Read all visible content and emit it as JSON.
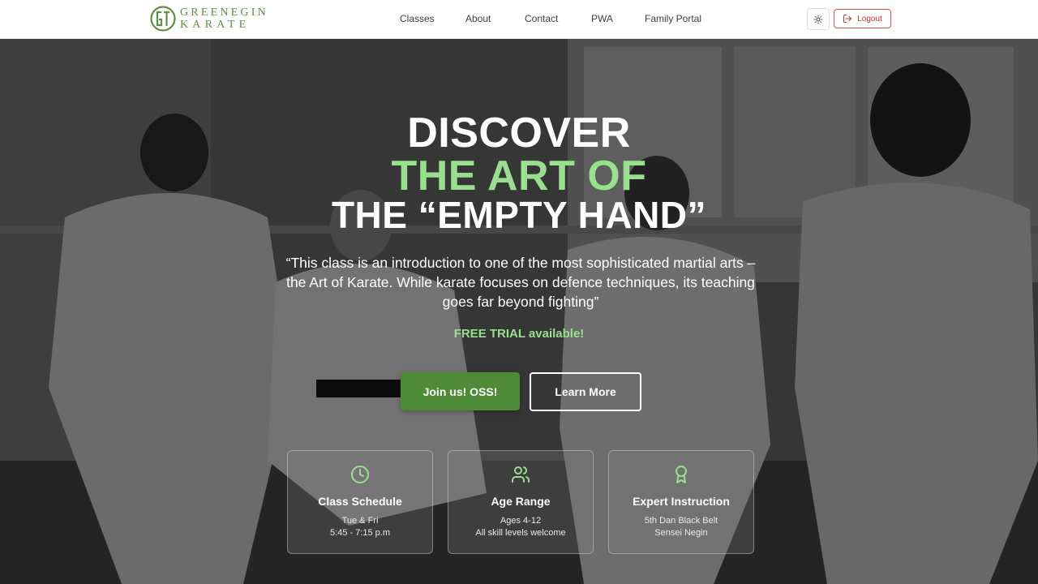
{
  "brand": {
    "line1": "GREENEGIN",
    "line2": "KARATE",
    "color": "#5e8f3f"
  },
  "nav": {
    "items": [
      "Classes",
      "About",
      "Contact",
      "PWA",
      "Family Portal"
    ]
  },
  "header_actions": {
    "theme_icon": "sun-icon",
    "logout_label": "Logout",
    "logout_icon": "logout-icon",
    "logout_color": "#c9302c"
  },
  "hero": {
    "line1": "DISCOVER",
    "line2": "THE ART OF",
    "line3": "THE “EMPTY HAND”",
    "accent_color": "#98e08e",
    "quote": "“This class is an introduction to one of the most sophisticated martial arts – the Art of Karate. While karate focuses on defence techniques, its teaching goes far beyond fighting”",
    "free_trial": "FREE TRIAL available!",
    "primary_button": "Join us! OSS!",
    "secondary_button": "Learn More",
    "primary_color": "#4f8a36"
  },
  "cards": [
    {
      "icon": "clock-icon",
      "title": "Class Schedule",
      "line1": "Tue & Fri",
      "line2": "5:45 - 7:15 p.m"
    },
    {
      "icon": "users-icon",
      "title": "Age Range",
      "line1": "Ages 4-12",
      "line2": "All skill levels welcome"
    },
    {
      "icon": "award-icon",
      "title": "Expert Instruction",
      "line1": "5th Dan Black Belt",
      "line2": "Sensei Negin"
    }
  ]
}
